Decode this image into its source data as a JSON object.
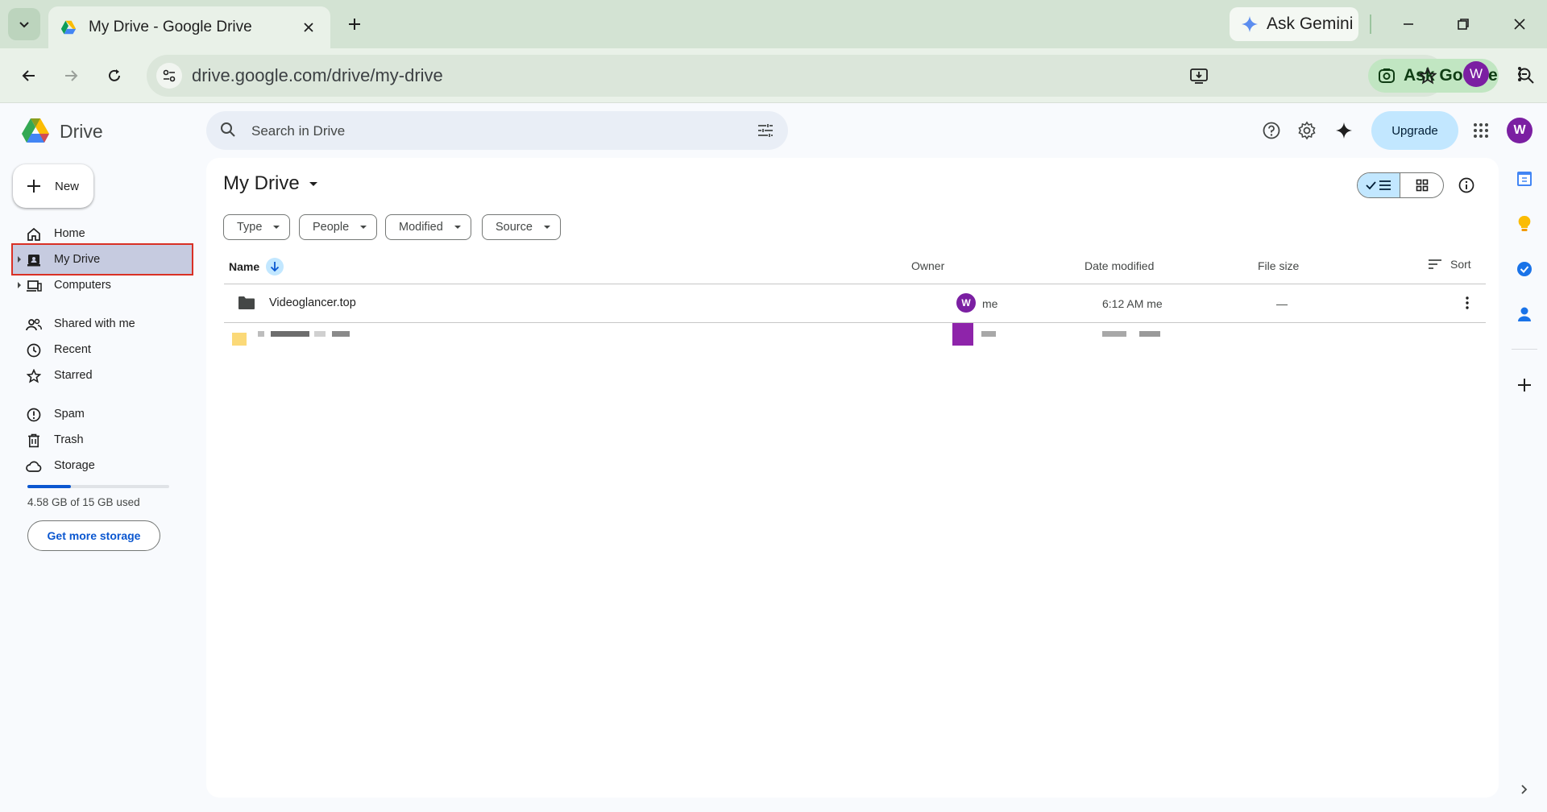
{
  "browser": {
    "tab_title": "My Drive - Google Drive",
    "gemini_label": "Ask Gemini",
    "url": "drive.google.com/drive/my-drive",
    "ask_google_label": "Ask Google",
    "profile_initial": "W"
  },
  "drive": {
    "logo_text": "Drive",
    "search_placeholder": "Search in Drive",
    "upgrade_label": "Upgrade",
    "avatar_initial": "W",
    "new_label": "New",
    "nav": {
      "home": "Home",
      "my_drive": "My Drive",
      "computers": "Computers",
      "shared": "Shared with me",
      "recent": "Recent",
      "starred": "Starred",
      "spam": "Spam",
      "trash": "Trash",
      "storage": "Storage"
    },
    "storage_used_fraction": 0.305,
    "storage_text": "4.58 GB of 15 GB used",
    "storage_button": "Get more storage",
    "main_title": "My Drive",
    "filters": [
      "Type",
      "People",
      "Modified",
      "Source"
    ],
    "columns": {
      "name": "Name",
      "owner": "Owner",
      "date_modified": "Date modified",
      "file_size": "File size",
      "sort": "Sort"
    },
    "rows": [
      {
        "name": "Videoglancer.top",
        "owner_initial": "W",
        "owner": "me",
        "modified": "6:12 AM me",
        "size": "—"
      }
    ]
  },
  "colors": {
    "accent": "#0b57d0",
    "selected": "#c2e7ff",
    "avatar": "#7b1fa2",
    "chrome_tabbar": "#d3e3d3"
  }
}
